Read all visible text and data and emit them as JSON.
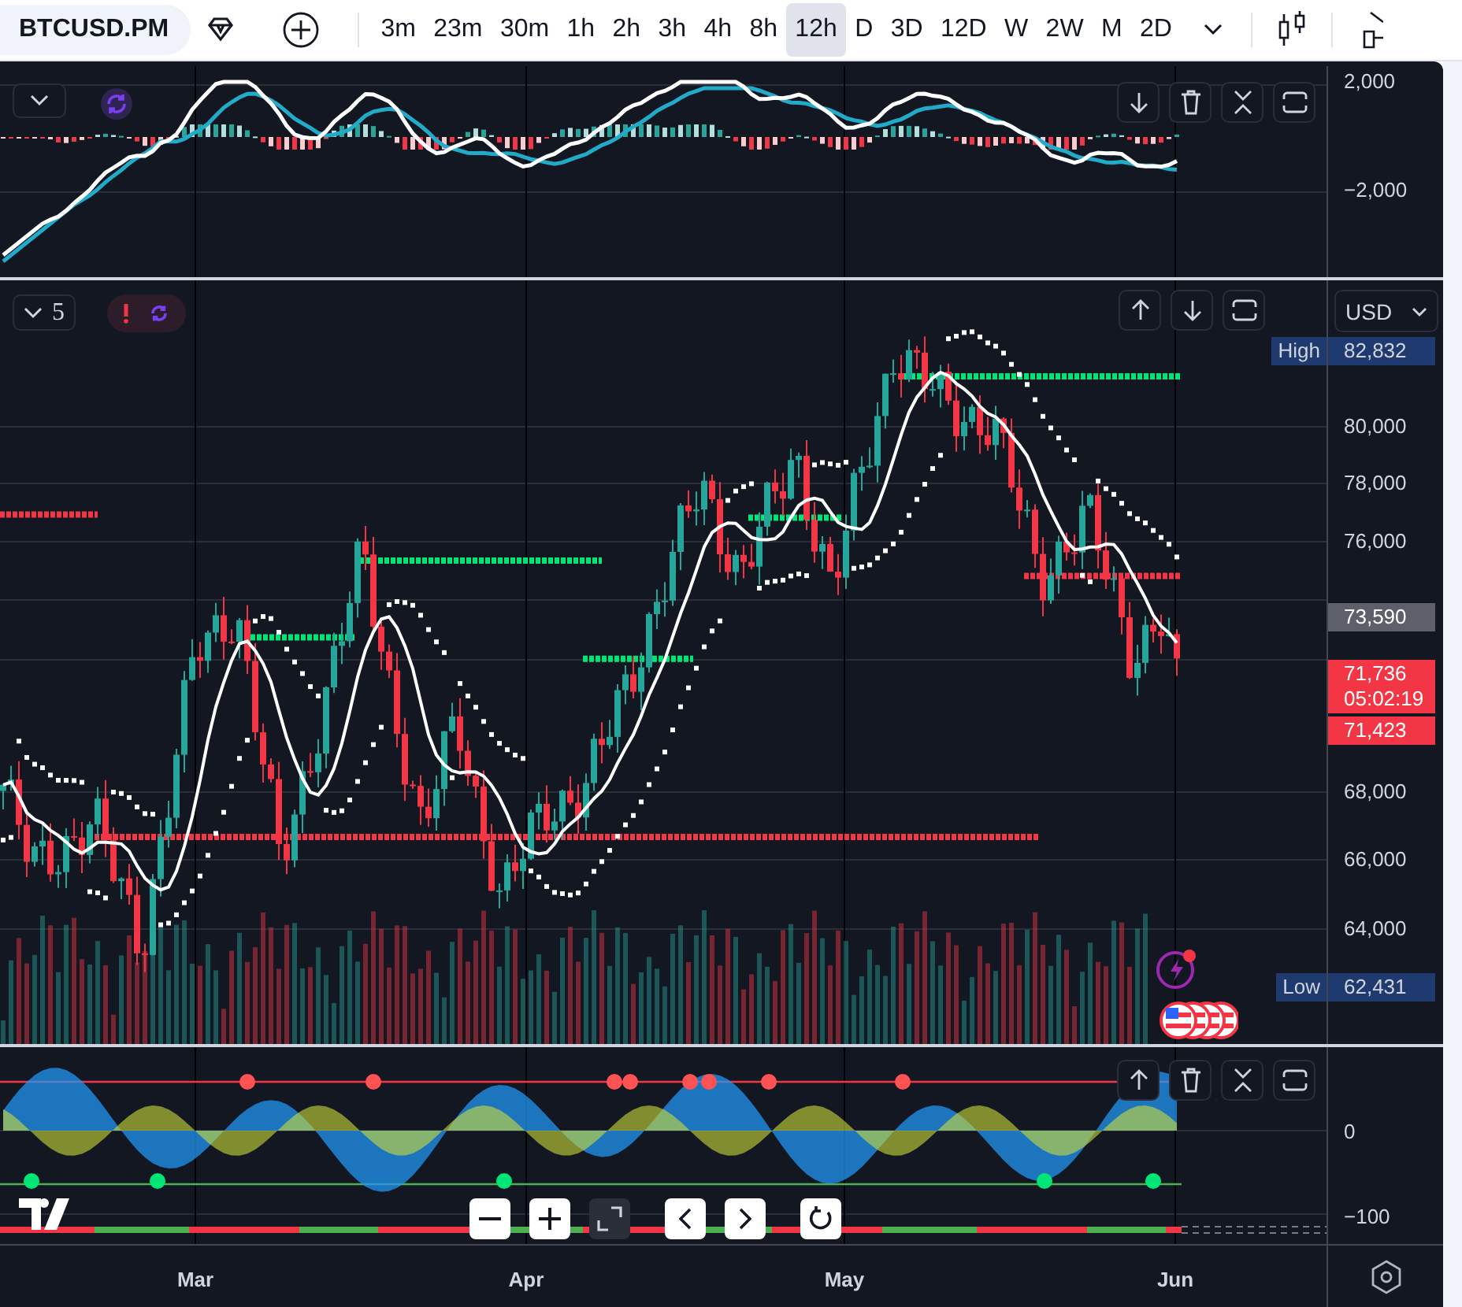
{
  "toolbar": {
    "symbol": "BTCUSD.PM",
    "intervals": [
      {
        "label": "3m",
        "selected": false
      },
      {
        "label": "23m",
        "selected": false
      },
      {
        "label": "30m",
        "selected": false
      },
      {
        "label": "1h",
        "selected": false
      },
      {
        "label": "2h",
        "selected": false
      },
      {
        "label": "3h",
        "selected": false
      },
      {
        "label": "4h",
        "selected": false
      },
      {
        "label": "8h",
        "selected": false
      },
      {
        "label": "12h",
        "selected": true
      },
      {
        "label": "D",
        "selected": false
      },
      {
        "label": "3D",
        "selected": false
      },
      {
        "label": "12D",
        "selected": false
      },
      {
        "label": "W",
        "selected": false
      },
      {
        "label": "2W",
        "selected": false
      },
      {
        "label": "M",
        "selected": false
      },
      {
        "label": "2D",
        "selected": false
      }
    ]
  },
  "macd_pane": {
    "scale": [
      "2,000",
      "−2,000"
    ]
  },
  "main_pane": {
    "indicators_count": "5",
    "currency": "USD",
    "scale": [
      "80,000",
      "78,000",
      "76,000",
      "68,000",
      "66,000",
      "64,000"
    ],
    "high": {
      "label": "High",
      "value": "82,832"
    },
    "low": {
      "label": "Low",
      "value": "62,431"
    },
    "markers": [
      {
        "value": "73,590",
        "color": "#5d606b"
      },
      {
        "value": "71,736",
        "countdown": "05:02:19",
        "color": "#f23645"
      },
      {
        "value": "71,423",
        "color": "#f23645"
      }
    ]
  },
  "oscillator_pane": {
    "scale": [
      "0",
      "−100"
    ]
  },
  "time_axis": {
    "labels": [
      "Mar",
      "Apr",
      "May",
      "Jun"
    ]
  }
}
